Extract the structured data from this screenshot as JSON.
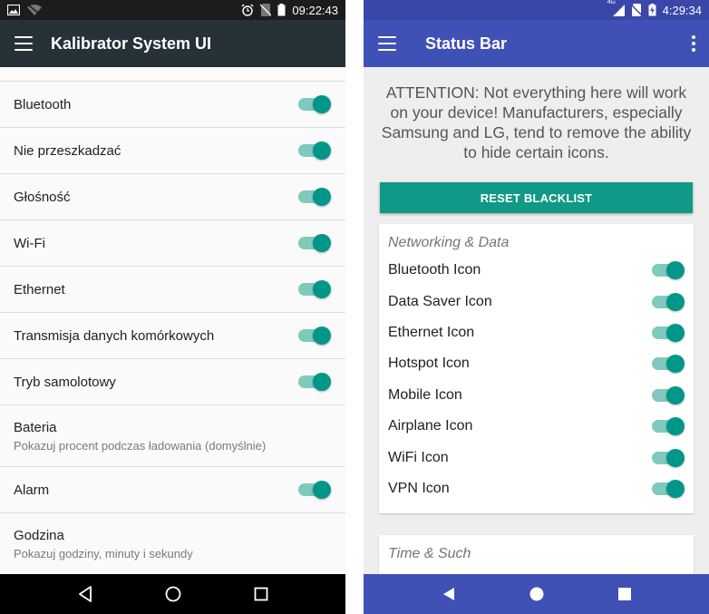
{
  "left": {
    "status_bar": {
      "time": "09:22:43"
    },
    "app_bar": {
      "title": "Kalibrator System UI"
    },
    "settings": [
      {
        "label": "Bluetooth",
        "toggle": true
      },
      {
        "label": "Nie przeszkadzać",
        "toggle": true
      },
      {
        "label": "Głośność",
        "toggle": true
      },
      {
        "label": "Wi-Fi",
        "toggle": true
      },
      {
        "label": "Ethernet",
        "toggle": true
      },
      {
        "label": "Transmisja danych komórkowych",
        "toggle": true
      },
      {
        "label": "Tryb samolotowy",
        "toggle": true
      },
      {
        "label": "Bateria",
        "subtitle": "Pokazuj procent podczas ładowania (domyślnie)",
        "toggle": false
      },
      {
        "label": "Alarm",
        "toggle": true
      },
      {
        "label": "Godzina",
        "subtitle": "Pokazuj godziny, minuty i sekundy",
        "toggle": false
      }
    ],
    "toggle_on_color": "#009688"
  },
  "right": {
    "status_bar": {
      "time": "4:29:34",
      "network": "4G"
    },
    "app_bar": {
      "title": "Status Bar"
    },
    "attention_text": "ATTENTION: Not everything here will work on your device! Manufacturers, especially Samsung and LG, tend to remove the ability to hide certain icons.",
    "reset_button": "RESET BLACKLIST",
    "sections": [
      {
        "title": "Networking & Data",
        "items": [
          {
            "label": "Bluetooth Icon",
            "toggle": true
          },
          {
            "label": "Data Saver Icon",
            "toggle": true
          },
          {
            "label": "Ethernet Icon",
            "toggle": true
          },
          {
            "label": "Hotspot Icon",
            "toggle": true
          },
          {
            "label": "Mobile Icon",
            "toggle": true
          },
          {
            "label": "Airplane Icon",
            "toggle": true
          },
          {
            "label": "WiFi Icon",
            "toggle": true
          },
          {
            "label": "VPN Icon",
            "toggle": true
          }
        ]
      },
      {
        "title": "Time & Such"
      }
    ],
    "accent_color": "#3f51b5"
  }
}
